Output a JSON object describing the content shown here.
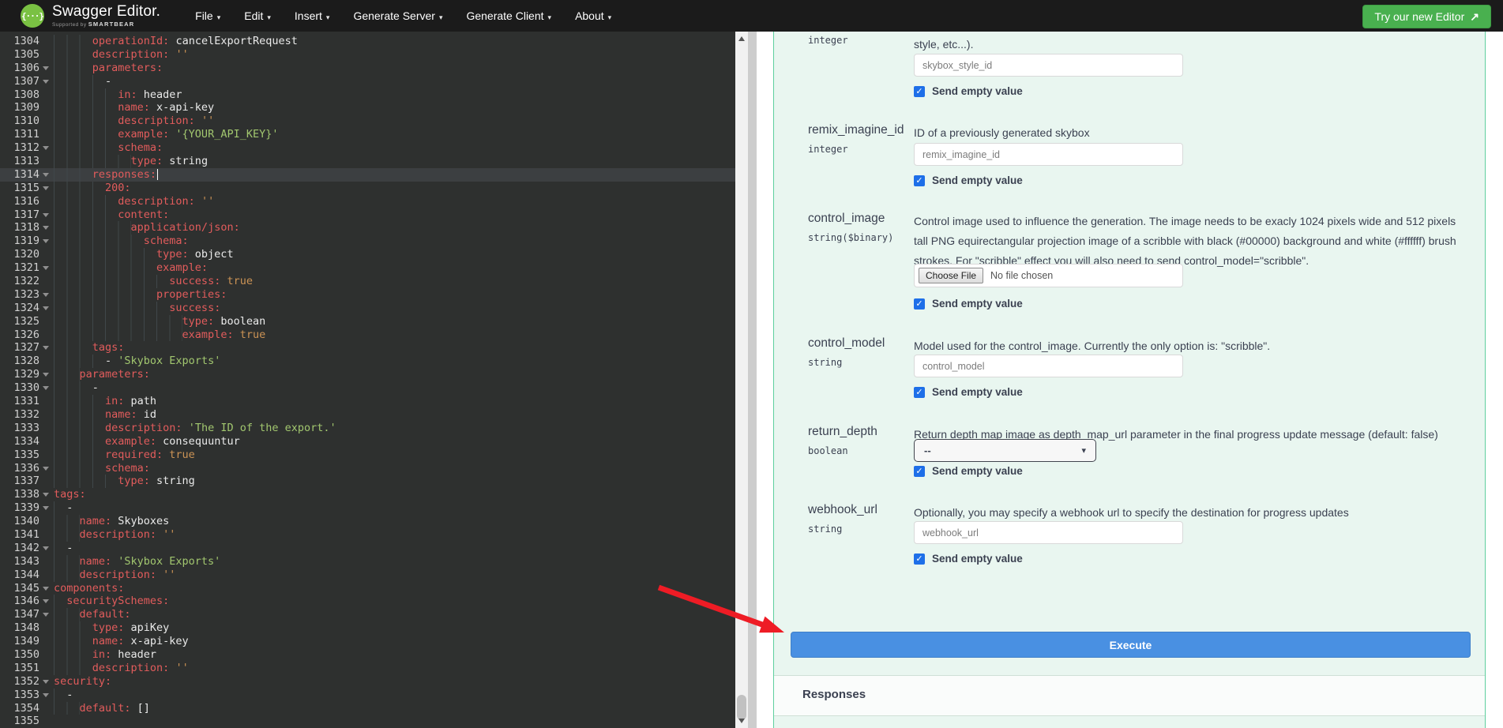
{
  "header": {
    "brand_title": "Swagger Editor.",
    "brand_sub_prefix": "Supported by",
    "brand_sub_name": "SMARTBEAR",
    "menus": [
      "File",
      "Edit",
      "Insert",
      "Generate Server",
      "Generate Client",
      "About"
    ],
    "cta_label": "Try our new Editor",
    "colors": {
      "header_bg": "#1b1b1b",
      "logo_green": "#7ac143",
      "cta_green": "#49b04f"
    }
  },
  "icons": {
    "logo_braces": "{···}",
    "menu_caret": "▾",
    "cta_arrow": "↗",
    "scroll_up": "▲",
    "scroll_down": "▼",
    "checkbox_check": "✓",
    "select_chevron": "▾"
  },
  "editor": {
    "current_line": 1314,
    "lines": [
      {
        "n": 1304,
        "i": 6,
        "f": false,
        "seg": [
          [
            "k",
            "operationId:"
          ],
          [
            "w",
            " cancelExportRequest"
          ]
        ]
      },
      {
        "n": 1305,
        "i": 6,
        "f": false,
        "seg": [
          [
            "k",
            "description:"
          ],
          [
            "o",
            " ''"
          ]
        ]
      },
      {
        "n": 1306,
        "i": 6,
        "f": true,
        "seg": [
          [
            "k",
            "parameters:"
          ]
        ]
      },
      {
        "n": 1307,
        "i": 8,
        "f": true,
        "seg": [
          [
            "w",
            "-"
          ]
        ]
      },
      {
        "n": 1308,
        "i": 10,
        "f": false,
        "seg": [
          [
            "k",
            "in:"
          ],
          [
            "w",
            " header"
          ]
        ]
      },
      {
        "n": 1309,
        "i": 10,
        "f": false,
        "seg": [
          [
            "k",
            "name:"
          ],
          [
            "w",
            " x-api-key"
          ]
        ]
      },
      {
        "n": 1310,
        "i": 10,
        "f": false,
        "seg": [
          [
            "k",
            "description:"
          ],
          [
            "o",
            " ''"
          ]
        ]
      },
      {
        "n": 1311,
        "i": 10,
        "f": false,
        "seg": [
          [
            "k",
            "example:"
          ],
          [
            "s",
            " '{YOUR_API_KEY}'"
          ]
        ]
      },
      {
        "n": 1312,
        "i": 10,
        "f": true,
        "seg": [
          [
            "k",
            "schema:"
          ]
        ]
      },
      {
        "n": 1313,
        "i": 12,
        "f": false,
        "seg": [
          [
            "k",
            "type:"
          ],
          [
            "w",
            " string"
          ]
        ]
      },
      {
        "n": 1314,
        "i": 6,
        "f": true,
        "cur": true,
        "seg": [
          [
            "k",
            "responses:"
          ]
        ]
      },
      {
        "n": 1315,
        "i": 8,
        "f": true,
        "seg": [
          [
            "k",
            "200:"
          ]
        ]
      },
      {
        "n": 1316,
        "i": 10,
        "f": false,
        "seg": [
          [
            "k",
            "description:"
          ],
          [
            "o",
            " ''"
          ]
        ]
      },
      {
        "n": 1317,
        "i": 10,
        "f": true,
        "seg": [
          [
            "k",
            "content:"
          ]
        ]
      },
      {
        "n": 1318,
        "i": 12,
        "f": true,
        "seg": [
          [
            "k",
            "application/json:"
          ]
        ]
      },
      {
        "n": 1319,
        "i": 14,
        "f": true,
        "seg": [
          [
            "k",
            "schema:"
          ]
        ]
      },
      {
        "n": 1320,
        "i": 16,
        "f": false,
        "seg": [
          [
            "k",
            "type:"
          ],
          [
            "w",
            " object"
          ]
        ]
      },
      {
        "n": 1321,
        "i": 16,
        "f": true,
        "seg": [
          [
            "k",
            "example:"
          ]
        ]
      },
      {
        "n": 1322,
        "i": 18,
        "f": false,
        "seg": [
          [
            "k",
            "success:"
          ],
          [
            "o",
            " true"
          ]
        ]
      },
      {
        "n": 1323,
        "i": 16,
        "f": true,
        "seg": [
          [
            "k",
            "properties:"
          ]
        ]
      },
      {
        "n": 1324,
        "i": 18,
        "f": true,
        "seg": [
          [
            "k",
            "success:"
          ]
        ]
      },
      {
        "n": 1325,
        "i": 20,
        "f": false,
        "seg": [
          [
            "k",
            "type:"
          ],
          [
            "w",
            " boolean"
          ]
        ]
      },
      {
        "n": 1326,
        "i": 20,
        "f": false,
        "seg": [
          [
            "k",
            "example:"
          ],
          [
            "o",
            " true"
          ]
        ]
      },
      {
        "n": 1327,
        "i": 6,
        "f": true,
        "seg": [
          [
            "k",
            "tags:"
          ]
        ]
      },
      {
        "n": 1328,
        "i": 8,
        "f": false,
        "seg": [
          [
            "w",
            "- "
          ],
          [
            "s",
            "'Skybox Exports'"
          ]
        ]
      },
      {
        "n": 1329,
        "i": 4,
        "f": true,
        "seg": [
          [
            "k",
            "parameters:"
          ]
        ]
      },
      {
        "n": 1330,
        "i": 6,
        "f": true,
        "seg": [
          [
            "w",
            "-"
          ]
        ]
      },
      {
        "n": 1331,
        "i": 8,
        "f": false,
        "seg": [
          [
            "k",
            "in:"
          ],
          [
            "w",
            " path"
          ]
        ]
      },
      {
        "n": 1332,
        "i": 8,
        "f": false,
        "seg": [
          [
            "k",
            "name:"
          ],
          [
            "w",
            " id"
          ]
        ]
      },
      {
        "n": 1333,
        "i": 8,
        "f": false,
        "seg": [
          [
            "k",
            "description:"
          ],
          [
            "s",
            " 'The ID of the export.'"
          ]
        ]
      },
      {
        "n": 1334,
        "i": 8,
        "f": false,
        "seg": [
          [
            "k",
            "example:"
          ],
          [
            "w",
            " consequuntur"
          ]
        ]
      },
      {
        "n": 1335,
        "i": 8,
        "f": false,
        "seg": [
          [
            "k",
            "required:"
          ],
          [
            "o",
            " true"
          ]
        ]
      },
      {
        "n": 1336,
        "i": 8,
        "f": true,
        "seg": [
          [
            "k",
            "schema:"
          ]
        ]
      },
      {
        "n": 1337,
        "i": 10,
        "f": false,
        "seg": [
          [
            "k",
            "type:"
          ],
          [
            "w",
            " string"
          ]
        ]
      },
      {
        "n": 1338,
        "i": 0,
        "f": true,
        "seg": [
          [
            "k",
            "tags:"
          ]
        ]
      },
      {
        "n": 1339,
        "i": 2,
        "f": true,
        "seg": [
          [
            "w",
            "-"
          ]
        ]
      },
      {
        "n": 1340,
        "i": 4,
        "f": false,
        "seg": [
          [
            "k",
            "name:"
          ],
          [
            "w",
            " Skyboxes"
          ]
        ]
      },
      {
        "n": 1341,
        "i": 4,
        "f": false,
        "seg": [
          [
            "k",
            "description:"
          ],
          [
            "o",
            " ''"
          ]
        ]
      },
      {
        "n": 1342,
        "i": 2,
        "f": true,
        "seg": [
          [
            "w",
            "-"
          ]
        ]
      },
      {
        "n": 1343,
        "i": 4,
        "f": false,
        "seg": [
          [
            "k",
            "name:"
          ],
          [
            "s",
            " 'Skybox Exports'"
          ]
        ]
      },
      {
        "n": 1344,
        "i": 4,
        "f": false,
        "seg": [
          [
            "k",
            "description:"
          ],
          [
            "o",
            " ''"
          ]
        ]
      },
      {
        "n": 1345,
        "i": 0,
        "f": true,
        "seg": [
          [
            "k",
            "components:"
          ]
        ]
      },
      {
        "n": 1346,
        "i": 2,
        "f": true,
        "seg": [
          [
            "k",
            "securitySchemes:"
          ]
        ]
      },
      {
        "n": 1347,
        "i": 4,
        "f": true,
        "seg": [
          [
            "k",
            "default:"
          ]
        ]
      },
      {
        "n": 1348,
        "i": 6,
        "f": false,
        "seg": [
          [
            "k",
            "type:"
          ],
          [
            "w",
            " apiKey"
          ]
        ]
      },
      {
        "n": 1349,
        "i": 6,
        "f": false,
        "seg": [
          [
            "k",
            "name:"
          ],
          [
            "w",
            " x-api-key"
          ]
        ]
      },
      {
        "n": 1350,
        "i": 6,
        "f": false,
        "seg": [
          [
            "k",
            "in:"
          ],
          [
            "w",
            " header"
          ]
        ]
      },
      {
        "n": 1351,
        "i": 6,
        "f": false,
        "seg": [
          [
            "k",
            "description:"
          ],
          [
            "o",
            " ''"
          ]
        ]
      },
      {
        "n": 1352,
        "i": 0,
        "f": true,
        "seg": [
          [
            "k",
            "security:"
          ]
        ]
      },
      {
        "n": 1353,
        "i": 2,
        "f": true,
        "seg": [
          [
            "w",
            "-"
          ]
        ]
      },
      {
        "n": 1354,
        "i": 4,
        "f": false,
        "seg": [
          [
            "k",
            "default:"
          ],
          [
            "w",
            " []"
          ]
        ]
      },
      {
        "n": 1355,
        "i": 0,
        "f": false,
        "seg": []
      }
    ]
  },
  "params": {
    "send_empty_label": "Send empty value",
    "file_button": "Choose File",
    "file_status": "No file chosen",
    "rows": [
      {
        "id": "pr1",
        "name": "",
        "type": "integer",
        "desc": "style, etc...).",
        "control": "text",
        "placeholder": "skybox_style_id"
      },
      {
        "id": "pr2",
        "name": "remix_imagine_id",
        "type": "integer",
        "desc": "ID of a previously generated skybox",
        "control": "text",
        "placeholder": "remix_imagine_id"
      },
      {
        "id": "pr3",
        "name": "control_image",
        "type": "string($binary)",
        "desc": "Control image used to influence the generation. The image needs to be exacly 1024 pixels wide and 512 pixels tall PNG equirectangular projection image of a scribble with black (#00000) background and white (#ffffff) brush strokes. For \"scribble\" effect you will also need to send control_model=\"scribble\".",
        "control": "file"
      },
      {
        "id": "pr4",
        "name": "control_model",
        "type": "string",
        "desc": "Model used for the control_image. Currently the only option is: \"scribble\".",
        "control": "text",
        "placeholder": "control_model"
      },
      {
        "id": "pr5",
        "name": "return_depth",
        "type": "boolean",
        "desc": "Return depth map image as depth_map_url parameter in the final progress update message (default: false)",
        "control": "select",
        "selected": "--"
      },
      {
        "id": "pr6",
        "name": "webhook_url",
        "type": "string",
        "desc": "Optionally, you may specify a webhook url to specify the destination for progress updates",
        "control": "text",
        "placeholder": "webhook_url"
      }
    ]
  },
  "actions": {
    "execute_label": "Execute"
  },
  "responses": {
    "title": "Responses"
  },
  "annotation": {
    "arrow_color": "#ee1c25"
  }
}
